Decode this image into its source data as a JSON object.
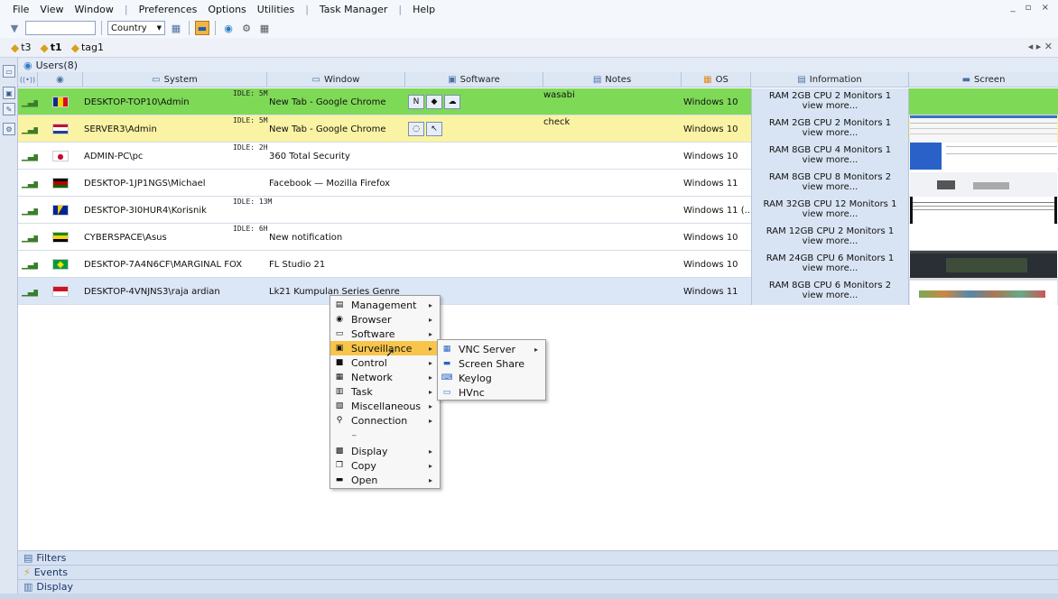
{
  "menubar": {
    "items": [
      "File",
      "View",
      "Window",
      "Preferences",
      "Options",
      "Utilities",
      "Task Manager",
      "Help"
    ],
    "window_controls": "_ ▫ ×"
  },
  "toolbar": {
    "filter_value": "",
    "country_label": "Country"
  },
  "tabs": [
    {
      "label": "t3",
      "active": false
    },
    {
      "label": "t1",
      "active": true
    },
    {
      "label": "tag1",
      "active": false
    }
  ],
  "users_header": "Users(8)",
  "columns": {
    "system": "System",
    "window": "Window",
    "software": "Software",
    "notes": "Notes",
    "os": "OS",
    "information": "Information",
    "screen": "Screen"
  },
  "rows": [
    {
      "system": "DESKTOP-TOP10\\Admin",
      "idle": "IDLE: 5M",
      "window": "New Tab - Google Chrome",
      "notes": "wasabi",
      "os": "Windows 10",
      "info1": "RAM 2GB  CPU 2  Monitors 1",
      "info2": "view more...",
      "bg": "#7ed957",
      "flag": [
        "#0b2e8c",
        "#f5d200",
        "#d80f1e"
      ],
      "flag_dir": "v",
      "software": [
        "N",
        "◆",
        "☁"
      ],
      "screen": "none"
    },
    {
      "system": "SERVER3\\Admin",
      "idle": "IDLE: 5M",
      "window": "New Tab - Google Chrome",
      "notes": "check",
      "os": "Windows 10",
      "info1": "RAM 2GB  CPU 2  Monitors 1",
      "info2": "view more...",
      "bg": "#fbf3a4",
      "flag": [
        "#c8102e",
        "#ffffff",
        "#1e428a"
      ],
      "flag_dir": "h",
      "software": [
        "◌",
        "↖"
      ],
      "screen": "web"
    },
    {
      "system": "ADMIN-PC\\pc",
      "idle": "IDLE: 2H",
      "window": "360 Total Security",
      "notes": "",
      "os": "Windows 10",
      "info1": "RAM 8GB  CPU 4  Monitors 1",
      "info2": "view more...",
      "bg": "#ffffff",
      "flag": [
        "#ffffff",
        "#ffffff",
        "#ffffff"
      ],
      "flag_dir": "kr",
      "software": [],
      "screen": "blue"
    },
    {
      "system": "DESKTOP-1JP1NGS\\Michael",
      "idle": "",
      "window": "Facebook — Mozilla Firefox",
      "notes": "",
      "os": "Windows 11",
      "info1": "RAM 8GB  CPU 8  Monitors 2",
      "info2": "view more...",
      "bg": "#ffffff",
      "flag": [
        "#000000",
        "#bb0000",
        "#006600"
      ],
      "flag_dir": "h",
      "software": [],
      "screen": "fb"
    },
    {
      "system": "DESKTOP-3I0HUR4\\Korisnik",
      "idle": "IDLE: 13M",
      "window": "",
      "notes": "",
      "os": "Windows 11 (...",
      "info1": "RAM 32GB  CPU 12  Monitors 1",
      "info2": "view more...",
      "bg": "#ffffff",
      "flag": [
        "#002395",
        "#fecb00",
        "#002395"
      ],
      "flag_dir": "ba",
      "software": [],
      "screen": "doc"
    },
    {
      "system": "CYBERSPACE\\Asus",
      "idle": "IDLE: 6H",
      "window": "New notification",
      "notes": "",
      "os": "Windows 10",
      "info1": "RAM 12GB  CPU 2  Monitors 1",
      "info2": "view more...",
      "bg": "#ffffff",
      "flag": [
        "#198a00",
        "#f7d116",
        "#000000"
      ],
      "flag_dir": "h",
      "software": [],
      "screen": "none"
    },
    {
      "system": "DESKTOP-7A4N6CF\\MARGINAL FOX",
      "idle": "",
      "window": "FL Studio 21",
      "notes": "",
      "os": "Windows 10",
      "info1": "RAM 24GB  CPU 6  Monitors 1",
      "info2": "view more...",
      "bg": "#ffffff",
      "flag": [
        "#009c3b",
        "#ffdf00",
        "#009c3b"
      ],
      "flag_dir": "br",
      "software": [],
      "screen": "dark"
    },
    {
      "system": "DESKTOP-4VNJNS3\\raja ardian",
      "idle": "",
      "window": "Lk21 Kumpulan Series Genre",
      "notes": "",
      "os": "Windows 11",
      "info1": "RAM 8GB  CPU 6  Monitors 2",
      "info2": "view more...",
      "bg": "#dbe6f6",
      "flag": [
        "#ce1126",
        "#ffffff",
        "#ffffff"
      ],
      "flag_dir": "h2",
      "software": [],
      "screen": "web2"
    }
  ],
  "context_menu": {
    "items": [
      {
        "label": "Management",
        "icon": "server-icon",
        "glyph": "▤",
        "submenu": true
      },
      {
        "label": "Browser",
        "icon": "browser-icon",
        "glyph": "◉",
        "submenu": true
      },
      {
        "label": "Software",
        "icon": "software-icon",
        "glyph": "▭",
        "submenu": true
      },
      {
        "label": "Surveillance",
        "icon": "surveillance-icon",
        "glyph": "▣",
        "submenu": true,
        "highlighted": true
      },
      {
        "label": "Control",
        "icon": "terminal-icon",
        "glyph": "■",
        "submenu": true
      },
      {
        "label": "Network",
        "icon": "network-icon",
        "glyph": "▦",
        "submenu": true
      },
      {
        "label": "Task",
        "icon": "task-icon",
        "glyph": "▥",
        "submenu": true
      },
      {
        "label": "Miscellaneous",
        "icon": "misc-icon",
        "glyph": "▧",
        "submenu": true
      },
      {
        "label": "Connection",
        "icon": "connection-icon",
        "glyph": "⚲",
        "submenu": true
      },
      {
        "label": "Display",
        "icon": "display-icon",
        "glyph": "▩",
        "submenu": true
      },
      {
        "label": "Copy",
        "icon": "copy-icon",
        "glyph": "❐",
        "submenu": true
      },
      {
        "label": "Open",
        "icon": "folder-icon",
        "glyph": "▬",
        "submenu": true
      }
    ],
    "separator": "_"
  },
  "submenu": {
    "items": [
      {
        "label": "VNC Server",
        "icon": "vnc-icon",
        "glyph": "▦",
        "submenu": true
      },
      {
        "label": "Screen Share",
        "icon": "screen-share-icon",
        "glyph": "▬",
        "submenu": false
      },
      {
        "label": "Keylog",
        "icon": "keyboard-icon",
        "glyph": "⌨",
        "submenu": false
      },
      {
        "label": "HVnc",
        "icon": "hvnc-icon",
        "glyph": "▭",
        "submenu": false
      }
    ]
  },
  "bottom_panels": [
    {
      "label": "Filters",
      "icon": "filter-icon",
      "glyph": "▤"
    },
    {
      "label": "Events",
      "icon": "events-icon",
      "glyph": "⚡"
    },
    {
      "label": "Display",
      "icon": "display-panel-icon",
      "glyph": "▥"
    }
  ],
  "colors": {
    "online_green": "#7ed957",
    "note_yellow": "#fbf3a4",
    "selected_blue": "#dbe6f6",
    "menu_highlight": "#f6c54a"
  }
}
